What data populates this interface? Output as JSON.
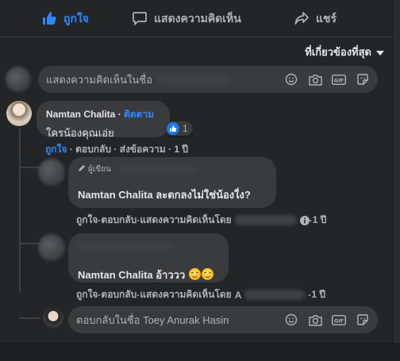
{
  "actions": {
    "like": "ถูกใจ",
    "comment": "แสดงความคิดเห็น",
    "share": "แชร์"
  },
  "sort": {
    "label": "ที่เกี่ยวข้องที่สุด"
  },
  "main_input": {
    "placeholder": "แสดงความคิดเห็นในชื่อ"
  },
  "comment1": {
    "author": "Namtan Chalita",
    "dot": " · ",
    "follow": "ติดตาม",
    "text": "ใครน้องคุณเอ่ย",
    "reaction_count": "1",
    "meta": {
      "like": "ถูกใจ",
      "reply": "ตอบกลับ",
      "send": "ส่งข้อความ",
      "time": "1 ปี",
      "sep": " · "
    }
  },
  "reply1": {
    "badge": "ผู้เขียน",
    "mention": "Namtan Chalita",
    "text": " ละตกลงไม่ใช่น้องใ่ง?",
    "meta": {
      "like": "ถูกใจ",
      "reply": "ตอบกลับ",
      "by": "แสดงความคิดเห็นโดย",
      "time": "1 ปี",
      "sep": " · "
    }
  },
  "reply2": {
    "mention": "Namtan Chalita",
    "text": " อ้าววว",
    "meta": {
      "like": "ถูกใจ",
      "reply": "ตอบกลับ",
      "by": "แสดงความคิดเห็นโดย",
      "initial": "A",
      "time": "1 ปี",
      "sep": " · "
    }
  },
  "reply_input": {
    "placeholder": "ตอบกลับในชื่อ Toey Anurak Hasin"
  },
  "icons": [
    "smile-icon",
    "camera-icon",
    "gif-icon",
    "sticker-icon"
  ],
  "colors": {
    "accent": "#2d88ff",
    "panel": "#242526",
    "bubble": "#3a3b3c",
    "muted": "#b0b3b8"
  }
}
